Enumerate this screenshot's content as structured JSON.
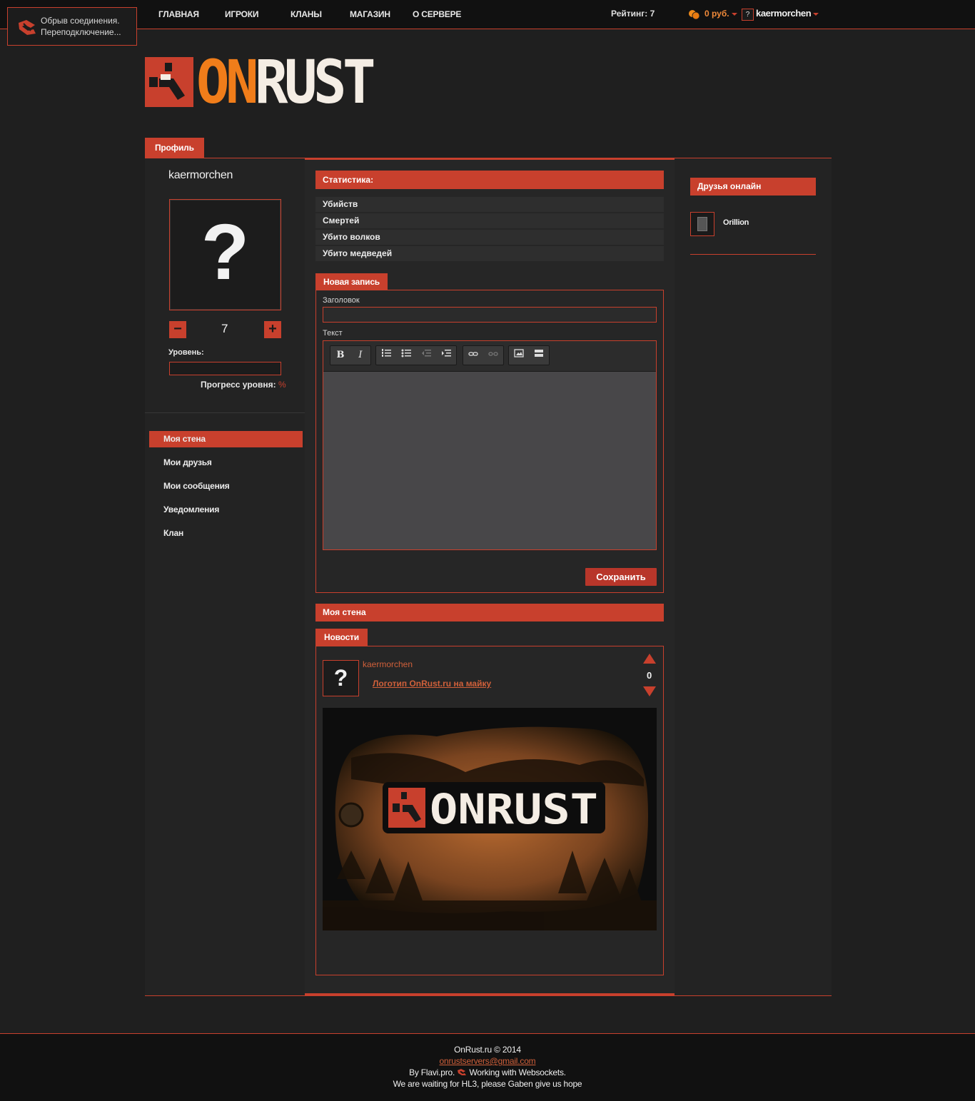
{
  "connection": {
    "line1": "Обрыв соединения.",
    "line2": "Переподключение..."
  },
  "nav": [
    "ГЛАВНАЯ",
    "ИГРОКИ",
    "КЛАНЫ",
    "МАГАЗИН",
    "О СЕРВЕРЕ"
  ],
  "user_bar": {
    "rating": "Рейтинг: 7",
    "money": "0 руб.",
    "avatar_char": "?",
    "username": "kaermorchen"
  },
  "logo": {
    "part1": "ON",
    "part2": "RUST"
  },
  "profile": {
    "tab": "Профиль",
    "name": "kaermorchen",
    "avatar_char": "?",
    "minus": "−",
    "plus": "+",
    "rating_value": "7",
    "level_label": "Уровень:",
    "progress_label": "Прогресс уровня:",
    "progress_pct": "%",
    "level_progress": 0
  },
  "menu": [
    "Моя стена",
    "Мои друзья",
    "Мои сообщения",
    "Уведомления",
    "Клан"
  ],
  "stats": {
    "title": "Статистика:",
    "rows": [
      "Убийств",
      "Смертей",
      "Убито волков",
      "Убито медведей"
    ]
  },
  "new_post": {
    "tab": "Новая запись",
    "title_label": "Заголовок",
    "text_label": "Текст",
    "title_value": "",
    "save": "Сохранить",
    "toolbar": {
      "bold": "B",
      "italic": "I"
    }
  },
  "wall": {
    "title": "Моя стена",
    "news_tab": "Новости",
    "post": {
      "avatar_char": "?",
      "author": "kaermorchen",
      "title": "Логотип OnRust.ru на майку",
      "votes": "0",
      "image_logo": "ONRUST"
    }
  },
  "friends": {
    "title": "Друзья онлайн",
    "items": [
      {
        "name": "Orillion"
      }
    ]
  },
  "footer": {
    "copyright": "OnRust.ru © 2014",
    "email": "onrustservers@gmail.com",
    "by": "By Flavi.pro.",
    "ws": "Working with Websockets.",
    "hope": "We are waiting for HL3, please Gaben give us hope"
  },
  "colors": {
    "accent": "#c8402d",
    "orange": "#f07d1a",
    "bg": "#1f1f1f"
  }
}
